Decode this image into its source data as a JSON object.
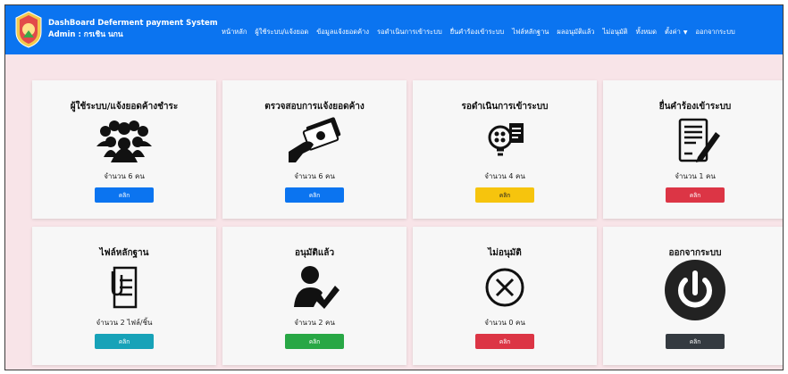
{
  "header": {
    "app_title": "DashBoard Deferment payment System",
    "user_label": "Admin : กรเชิน นกน"
  },
  "nav": {
    "items": [
      {
        "label": "หน้าหลัก"
      },
      {
        "label": "ผู้ใช้ระบบ/แจ้งยอด"
      },
      {
        "label": "ข้อมูลแจ้งยอดค้าง"
      },
      {
        "label": "รอดำเนินการเข้าระบบ"
      },
      {
        "label": "ยื่นคำร้องเข้าระบบ"
      },
      {
        "label": "ไฟล์หลักฐาน"
      },
      {
        "label": "ผลอนุมัติแล้ว"
      },
      {
        "label": "ไม่อนุมัติ"
      },
      {
        "label": "ทั้งหมด"
      },
      {
        "label": "ตั้งค่า"
      },
      {
        "label": "ออกจากระบบ"
      }
    ]
  },
  "cards": [
    {
      "title": "ผู้ใช้ระบบ/แจ้งยอดค้างชำระ",
      "count": "จำนวน 6 คน",
      "button": "คลิก",
      "icon": "users-group-icon",
      "button_color": "#0b74f0"
    },
    {
      "title": "ตรวจสอบการแจ้งยอดค้าง",
      "count": "จำนวน 6 คน",
      "button": "คลิก",
      "icon": "money-hand-icon",
      "button_color": "#0b74f0"
    },
    {
      "title": "รอดำเนินการเข้าระบบ",
      "count": "จำนวน 4 คน",
      "button": "คลิก",
      "icon": "idea-document-icon",
      "button_color": "#f6c40d"
    },
    {
      "title": "ยื่นคำร้องเข้าระบบ",
      "count": "จำนวน 1 คน",
      "button": "คลิก",
      "icon": "contract-pen-icon",
      "button_color": "#dc3545"
    },
    {
      "title": "ไฟล์หลักฐาน",
      "count": "จำนวน 2 ไฟล์/ชิ้น",
      "button": "คลิก",
      "icon": "document-clip-icon",
      "button_color": "#17a2b8"
    },
    {
      "title": "อนุมัติแล้ว",
      "count": "จำนวน 2 คน",
      "button": "คลิก",
      "icon": "user-check-icon",
      "button_color": "#28a745"
    },
    {
      "title": "ไม่อนุมัติ",
      "count": "จำนวน 0 คน",
      "button": "คลิก",
      "icon": "circle-x-icon",
      "button_color": "#dc3545"
    },
    {
      "title": "ออกจากระบบ",
      "count": "",
      "button": "คลิก",
      "icon": "power-icon",
      "button_color": "#343a40"
    }
  ]
}
